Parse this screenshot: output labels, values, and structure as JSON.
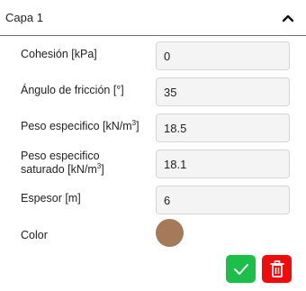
{
  "header": {
    "title": "Capa 1"
  },
  "fields": {
    "cohesion": {
      "label": "Cohesión [kPa]",
      "value": "0"
    },
    "friccion": {
      "label": "Ángulo de fricción [°]",
      "value": "35"
    },
    "peso": {
      "label_prefix": "Peso especifico [kN/m",
      "label_exp": "3",
      "label_suffix": "]",
      "value": "18.5"
    },
    "peso_sat": {
      "label_line1": "Peso especifico",
      "label_prefix": "saturado [kN/m",
      "label_exp": "3",
      "label_suffix": "]",
      "value": "18.1"
    },
    "espesor": {
      "label": "Espesor [m]",
      "value": "6"
    },
    "color": {
      "label": "Color",
      "value": "#a57a5a"
    }
  },
  "actions": {
    "confirm": {
      "icon": "check-icon",
      "color": "#1bbf4a"
    },
    "delete": {
      "icon": "trash-icon",
      "color": "#f20b0b"
    }
  },
  "colors": {
    "accent_border": "#6f6f6f",
    "input_bg": "#f4f4f4"
  }
}
